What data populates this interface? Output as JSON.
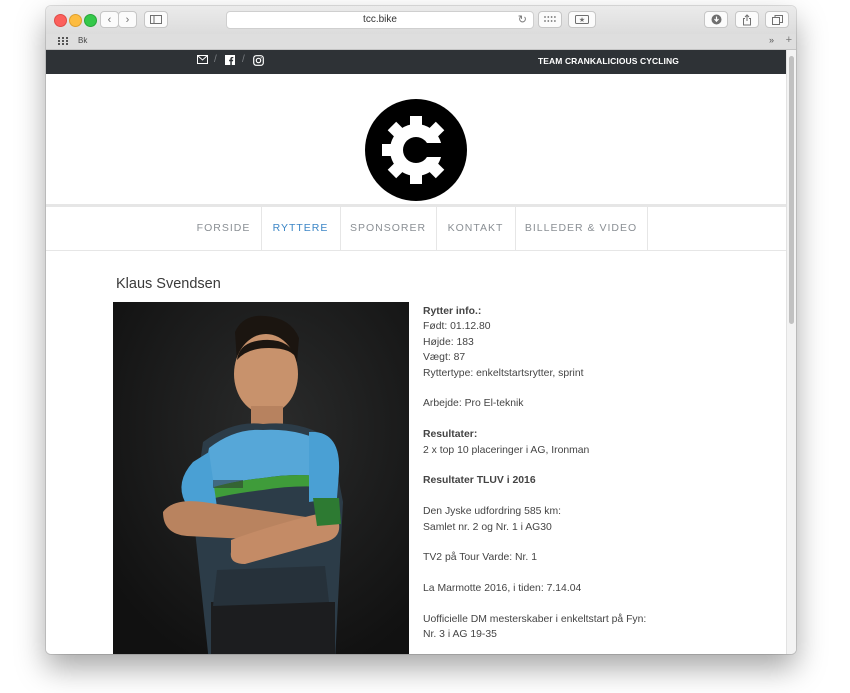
{
  "browser": {
    "url": "tcc.bike",
    "bookmark": "Bk"
  },
  "site": {
    "team_name": "TEAM CRANKALICIOUS CYCLING",
    "nav": [
      "FORSIDE",
      "RYTTERE",
      "SPONSORER",
      "KONTAKT",
      "BILLEDER & VIDEO"
    ],
    "active_nav": "RYTTERE",
    "accent_color": "#3b86c6",
    "topbar_color": "#2e3236",
    "social_icons": [
      "mail-icon",
      "facebook-icon",
      "instagram-icon"
    ]
  },
  "rider": {
    "name": "Klaus Svendsen",
    "info_heading": "Rytter info.:",
    "fodt": "Født: 01.12.80",
    "hojde": "Højde: 183",
    "vaegt": "Vægt: 87",
    "type": "Ryttertype: enkeltstartsrytter, sprint",
    "arbejde": "Arbejde: Pro El-teknik",
    "resultater_heading": "Resultater:",
    "resultater_1": "2 x top 10 placeringer i AG, Ironman",
    "tluv_heading": "Resultater TLUV i 2016",
    "jyske_1": "Den Jyske udfordring 585 km:",
    "jyske_2": "Samlet nr. 2 og Nr. 1 i AG30",
    "tv2": "TV2 på Tour Varde: Nr. 1",
    "marmotte": "La Marmotte 2016, i tiden: 7.14.04",
    "dm_1": "Uofficielle DM mesterskaber i enkeltstart på Fyn:",
    "dm_2": "Nr. 3 i AG 19-35"
  }
}
